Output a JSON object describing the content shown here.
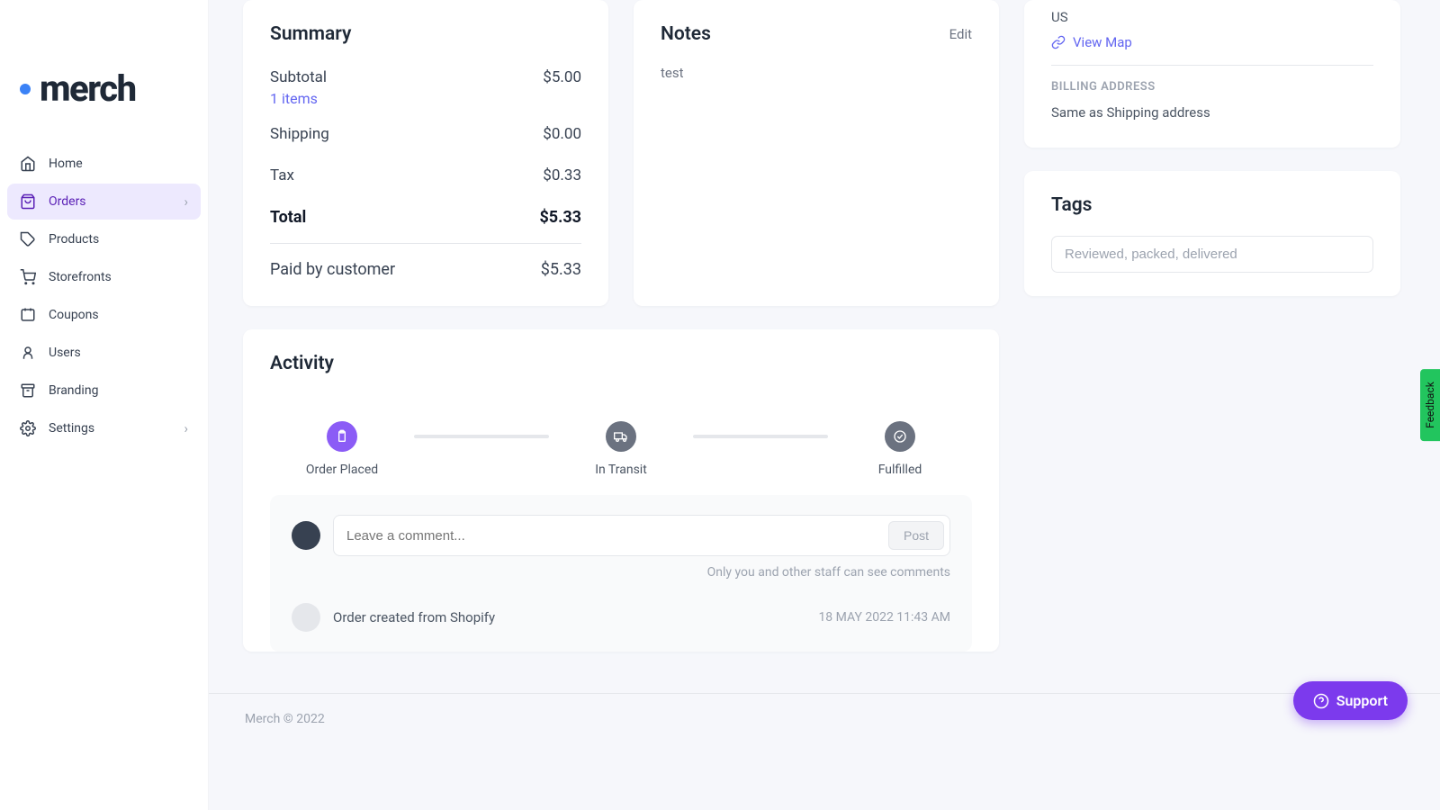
{
  "logo": {
    "text": "merch"
  },
  "nav": {
    "home": "Home",
    "orders": "Orders",
    "products": "Products",
    "storefronts": "Storefronts",
    "coupons": "Coupons",
    "users": "Users",
    "branding": "Branding",
    "settings": "Settings"
  },
  "summary": {
    "title": "Summary",
    "subtotal_label": "Subtotal",
    "subtotal_value": "$5.00",
    "items_link": "1 items",
    "shipping_label": "Shipping",
    "shipping_value": "$0.00",
    "tax_label": "Tax",
    "tax_value": "$0.33",
    "total_label": "Total",
    "total_value": "$5.33",
    "paid_label": "Paid by customer",
    "paid_value": "$5.33"
  },
  "notes": {
    "title": "Notes",
    "edit": "Edit",
    "body": "test"
  },
  "activity": {
    "title": "Activity",
    "step1": "Order Placed",
    "step2": "In Transit",
    "step3": "Fulfilled",
    "comment_placeholder": "Leave a comment...",
    "post": "Post",
    "privacy": "Only you and other staff can see comments",
    "log_text": "Order created from Shopify",
    "log_time": "18 MAY 2022 11:43 AM"
  },
  "address": {
    "country": "US",
    "view_map": "View Map",
    "billing_title": "BILLING ADDRESS",
    "billing_same": "Same as Shipping address"
  },
  "tags": {
    "title": "Tags",
    "placeholder": "Reviewed, packed, delivered"
  },
  "footer": {
    "copyright": "Merch © 2022"
  },
  "support": {
    "label": "Support"
  },
  "feedback": {
    "label": "Feedback"
  }
}
